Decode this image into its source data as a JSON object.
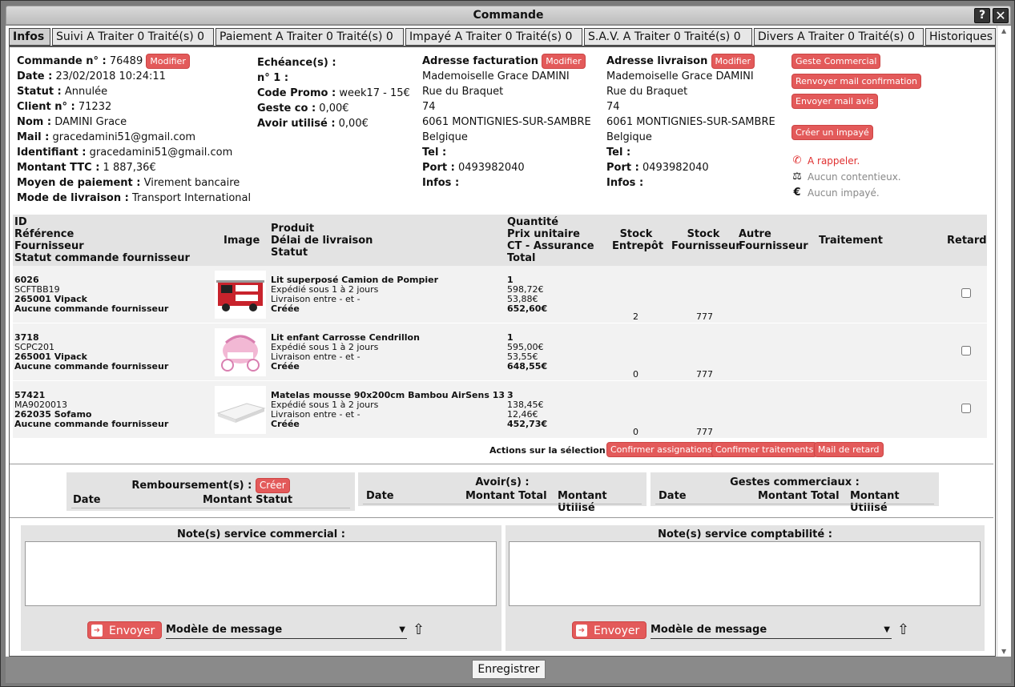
{
  "window": {
    "title": "Commande"
  },
  "tabs": [
    {
      "label": "Infos"
    },
    {
      "label": "Suivi A Traiter 0 Traité(s) 0"
    },
    {
      "label": "Paiement A Traiter 0 Traité(s) 0"
    },
    {
      "label": "Impayé A Traiter 0 Traité(s) 0"
    },
    {
      "label": "S.A.V. A Traiter 0 Traité(s) 0"
    },
    {
      "label": "Divers A Traiter 0 Traité(s) 0"
    },
    {
      "label": "Historiques"
    }
  ],
  "order": {
    "number_label": "Commande n° :",
    "number": "76489",
    "modify": "Modifier",
    "date_label": "Date :",
    "date": "23/02/2018 10:24:11",
    "status_label": "Statut :",
    "status": "Annulée",
    "client_label": "Client n° :",
    "client": "71232",
    "name_label": "Nom :",
    "name": "DAMINI Grace",
    "mail_label": "Mail :",
    "mail": "gracedamini51@gmail.com",
    "login_label": "Identifiant :",
    "login": "gracedamini51@gmail.com",
    "amount_label": "Montant TTC :",
    "amount": "1 887,36€",
    "payment_label": "Moyen de paiement :",
    "payment": "Virement bancaire",
    "delivery_label": "Mode de livraison :",
    "delivery": "Transport International"
  },
  "schedule": {
    "title": "Echéance(s) :",
    "n1_label": "n° 1 :",
    "promo_label": "Code Promo :",
    "promo": "week17 - 15€",
    "geste_label": "Geste co :",
    "geste": "0,00€",
    "avoir_label": "Avoir utilisé :",
    "avoir": "0,00€"
  },
  "billing": {
    "title": "Adresse facturation",
    "modify": "Modifier",
    "name": "Mademoiselle Grace DAMINI",
    "street": "Rue du Braquet",
    "number": "74",
    "city": "6061 MONTIGNIES-SUR-SAMBRE",
    "country": "Belgique",
    "tel_label": "Tel :",
    "mobile_label": "Port :",
    "mobile": "0493982040",
    "infos_label": "Infos :"
  },
  "shipping": {
    "title": "Adresse livraison",
    "modify": "Modifier",
    "name": "Mademoiselle Grace DAMINI",
    "street": "Rue du Braquet",
    "number": "74",
    "city": "6061 MONTIGNIES-SUR-SAMBRE",
    "country": "Belgique",
    "tel_label": "Tel :",
    "mobile_label": "Port :",
    "mobile": "0493982040",
    "infos_label": "Infos :"
  },
  "actions": {
    "geste": "Geste Commercial",
    "resend": "Renvoyer mail confirmation",
    "review": "Envoyer mail avis",
    "unpaid": "Créer un impayé",
    "callback": "A rappeler.",
    "no_dispute": "Aucun contentieux.",
    "no_unpaid": "Aucun impayé."
  },
  "colors": {
    "accent": "#e35a5a",
    "callback": "#e03030",
    "muted": "#888888"
  },
  "grid": {
    "headers": {
      "id": "ID",
      "ref": "Référence",
      "supplier": "Fournisseur",
      "supstatus": "Statut commande fournisseur",
      "image": "Image",
      "product": "Produit",
      "delay": "Délai de livraison",
      "pstatus": "Statut",
      "qty": "Quantité",
      "unit": "Prix unitaire",
      "ct": "CT - Assurance",
      "total": "Total",
      "stock1a": "Stock",
      "stock1b": "Entrepôt",
      "stock2a": "Stock",
      "stock2b": "Fournisseur",
      "other_a": "Autre",
      "other_b": "Fournisseur",
      "processing": "Traitement",
      "delay_col": "Retard"
    },
    "rows": [
      {
        "id": "6026",
        "ref": "SCFTBB19",
        "supplier": "265001 Vipack",
        "supstatus": "Aucune commande fournisseur",
        "product": "Lit superposé Camion de Pompier",
        "ship": "Expédié sous 1 à 2 jours",
        "delivery": "Livraison entre - et -",
        "status": "Créée",
        "qty": "1",
        "unit": "598,72€",
        "ct": "53,88€",
        "total": "652,60€",
        "stock_wh": "2",
        "stock_sup": "777",
        "image": "fire-truck-bed"
      },
      {
        "id": "3718",
        "ref": "SCPC201",
        "supplier": "265001 Vipack",
        "supstatus": "Aucune commande fournisseur",
        "product": "Lit enfant Carrosse Cendrillon",
        "ship": "Expédié sous 1 à 2 jours",
        "delivery": "Livraison entre - et -",
        "status": "Créée",
        "qty": "1",
        "unit": "595,00€",
        "ct": "53,55€",
        "total": "648,55€",
        "stock_wh": "0",
        "stock_sup": "777",
        "image": "carriage-bed"
      },
      {
        "id": "57421",
        "ref": "MA9020013",
        "supplier": "262035 Sofamo",
        "supstatus": "Aucune commande fournisseur",
        "product": "Matelas mousse 90x200cm Bambou AirSens 13",
        "ship": "Expédié sous 1 à 2 jours",
        "delivery": "Livraison entre - et -",
        "status": "Créée",
        "qty": "3",
        "unit": "138,45€",
        "ct": "12,46€",
        "total": "452,73€",
        "stock_wh": "0",
        "stock_sup": "777",
        "image": "mattress"
      }
    ],
    "selection_label": "Actions sur la sélection :",
    "confirm_assign": "Confirmer assignations",
    "confirm_proc": "Confirmer traitements",
    "delay_mail": "Mail de retard"
  },
  "refunds": {
    "title": "Remboursement(s) :",
    "create": "Créer",
    "date": "Date",
    "amount_status": "Montant Statut"
  },
  "credits": {
    "title": "Avoir(s) :",
    "date": "Date",
    "total": "Montant Total",
    "used": "Montant Utilisé"
  },
  "gestures": {
    "title": "Gestes commerciaux :",
    "date": "Date",
    "total": "Montant Total",
    "used": "Montant Utilisé"
  },
  "notes_commercial": {
    "title": "Note(s) service commercial :",
    "send": "Envoyer",
    "template": "Modèle de message",
    "value": ""
  },
  "notes_accounting": {
    "title": "Note(s) service comptabilité :",
    "send": "Envoyer",
    "template": "Modèle de message",
    "value": ""
  },
  "footer": {
    "save": "Enregistrer"
  }
}
